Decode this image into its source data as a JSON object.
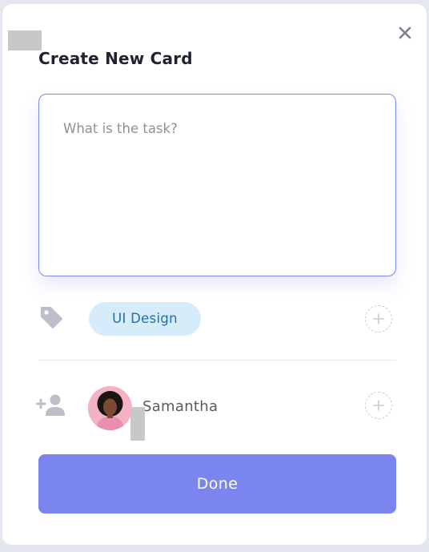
{
  "dialog": {
    "title": "Create New Card",
    "close_icon": "close-icon"
  },
  "task": {
    "value": "",
    "placeholder": "What is the task?"
  },
  "tags": {
    "icon": "tag-icon",
    "items": [
      {
        "label": "UI Design",
        "color": "#d6ecfb",
        "text_color": "#1f6fb0"
      }
    ],
    "add_icon": "plus-icon"
  },
  "assignees": {
    "icon": "add-user-icon",
    "items": [
      {
        "name": "Samantha",
        "avatar": "avatar-samantha"
      }
    ],
    "add_icon": "plus-icon"
  },
  "actions": {
    "done_label": "Done"
  },
  "colors": {
    "accent": "#7a85ee",
    "focus_border": "#7f86ee",
    "icon_gray": "#b9bcc6"
  }
}
